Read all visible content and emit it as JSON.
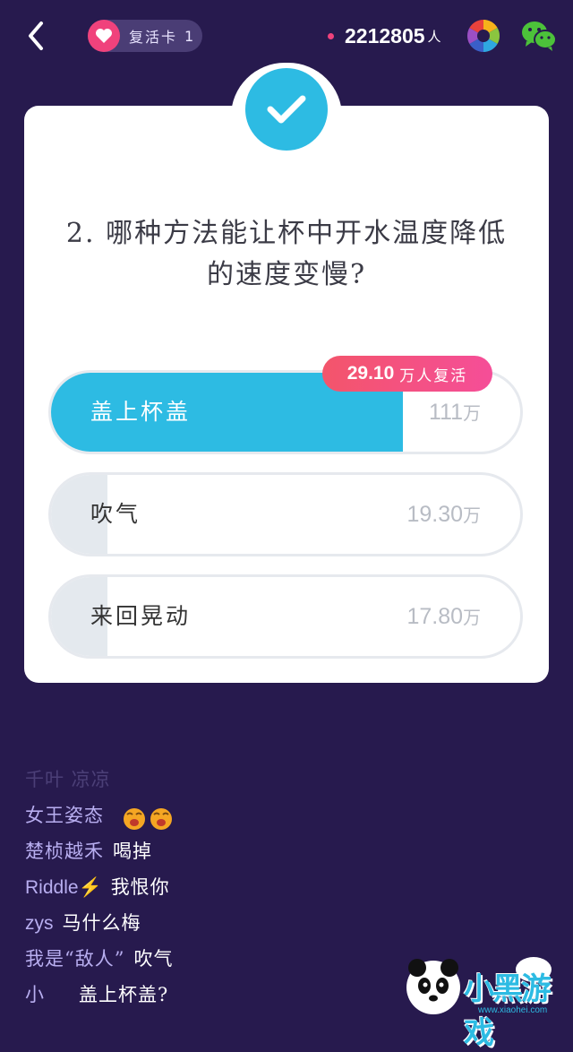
{
  "header": {
    "revive_card_label": "复活卡",
    "revive_card_count": "1",
    "online_count": "2212805",
    "online_unit": "人"
  },
  "question": {
    "line1": "2. 哪种方法能让杯中开水温度降低",
    "line2": "的速度变慢?"
  },
  "options": [
    {
      "label": "盖上杯盖",
      "count": "111",
      "unit": "万",
      "fill_fraction": 0.75,
      "correct": true
    },
    {
      "label": "吹气",
      "count": "19.30",
      "unit": "万",
      "fill_fraction": 0.12,
      "correct": false
    },
    {
      "label": "来回晃动",
      "count": "17.80",
      "unit": "万",
      "fill_fraction": 0.12,
      "correct": false
    }
  ],
  "revive_badge": {
    "number": "29.10",
    "text": "万人复活"
  },
  "chat": [
    {
      "name": "千叶 凉凉",
      "message": ""
    },
    {
      "name": "女王姿态",
      "message": ""
    },
    {
      "name": "楚桢越禾",
      "message": "喝掉"
    },
    {
      "name": "Riddle⚡",
      "message": "我恨你"
    },
    {
      "name": "zys",
      "message": "马什么梅"
    },
    {
      "name": "我是“敌人”",
      "message": "吹气"
    },
    {
      "name": "小",
      "message": "盖上杯盖?"
    }
  ],
  "watermark": {
    "title": "小黑游戏",
    "site": "www.xiaohei.com"
  },
  "colors": {
    "background": "#271a4e",
    "accent": "#2dbbe3",
    "pink": "#f0427c"
  },
  "icons": [
    "back-arrow-icon",
    "heart-icon",
    "share-aperture-icon",
    "wechat-icon",
    "check-icon"
  ]
}
